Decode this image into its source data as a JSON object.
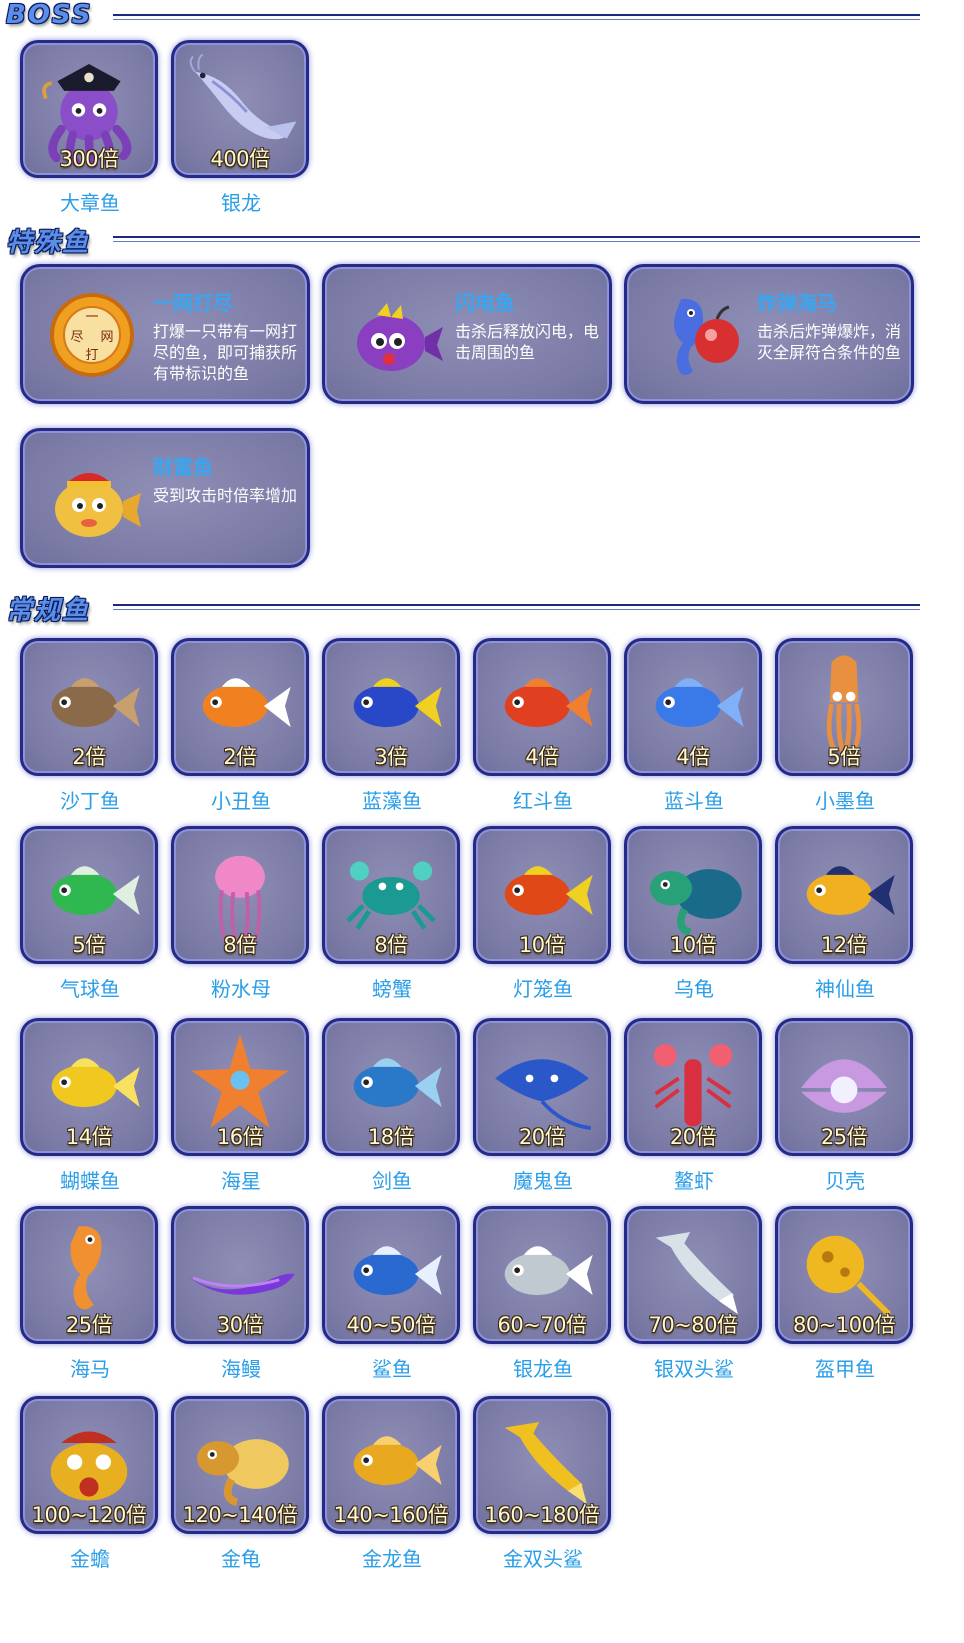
{
  "sections": {
    "boss": "BOSS",
    "special": "特殊鱼",
    "regular": "常规鱼"
  },
  "boss": [
    {
      "name": "大章鱼",
      "mult": "300倍",
      "icon": "purple-octopus-pirate-icon"
    },
    {
      "name": "银龙",
      "mult": "400倍",
      "icon": "silver-dragon-icon"
    }
  ],
  "special": [
    {
      "title": "一网打尽",
      "desc": "打爆一只带有一网打尽的鱼，即可捕获所有带标识的鱼",
      "icon": "one-net-coin-icon"
    },
    {
      "title": "闪电鱼",
      "desc": "击杀后释放闪电，电击周围的鱼",
      "icon": "lightning-pufferfish-icon"
    },
    {
      "title": "炸弹海马",
      "desc": "击杀后炸弹爆炸，消灭全屏符合条件的鱼",
      "icon": "bomb-seahorse-icon"
    },
    {
      "title": "财富鱼",
      "desc": "受到攻击时倍率增加",
      "icon": "fortune-fish-icon"
    }
  ],
  "regular": [
    {
      "name": "沙丁鱼",
      "mult": "2倍",
      "icon": "sardine-icon"
    },
    {
      "name": "小丑鱼",
      "mult": "2倍",
      "icon": "clownfish-icon"
    },
    {
      "name": "蓝藻鱼",
      "mult": "3倍",
      "icon": "blue-tang-icon"
    },
    {
      "name": "红斗鱼",
      "mult": "4倍",
      "icon": "red-betta-icon"
    },
    {
      "name": "蓝斗鱼",
      "mult": "4倍",
      "icon": "blue-betta-icon"
    },
    {
      "name": "小墨鱼",
      "mult": "5倍",
      "icon": "squid-icon"
    },
    {
      "name": "气球鱼",
      "mult": "5倍",
      "icon": "balloon-fish-icon"
    },
    {
      "name": "粉水母",
      "mult": "8倍",
      "icon": "pink-jellyfish-icon"
    },
    {
      "name": "螃蟹",
      "mult": "8倍",
      "icon": "crab-icon"
    },
    {
      "name": "灯笼鱼",
      "mult": "10倍",
      "icon": "lanternfish-icon"
    },
    {
      "name": "乌龟",
      "mult": "10倍",
      "icon": "turtle-icon"
    },
    {
      "name": "神仙鱼",
      "mult": "12倍",
      "icon": "angelfish-icon"
    },
    {
      "name": "蝴蝶鱼",
      "mult": "14倍",
      "icon": "butterfly-fish-icon"
    },
    {
      "name": "海星",
      "mult": "16倍",
      "icon": "starfish-icon"
    },
    {
      "name": "剑鱼",
      "mult": "18倍",
      "icon": "swordfish-icon"
    },
    {
      "name": "魔鬼鱼",
      "mult": "20倍",
      "icon": "manta-ray-icon"
    },
    {
      "name": "鳌虾",
      "mult": "20倍",
      "icon": "lobster-icon"
    },
    {
      "name": "贝壳",
      "mult": "25倍",
      "icon": "pearl-shell-icon"
    },
    {
      "name": "海马",
      "mult": "25倍",
      "icon": "seahorse-icon"
    },
    {
      "name": "海鳗",
      "mult": "30倍",
      "icon": "eel-icon"
    },
    {
      "name": "鲨鱼",
      "mult": "40~50倍",
      "icon": "shark-icon"
    },
    {
      "name": "银龙鱼",
      "mult": "60~70倍",
      "icon": "silver-arowana-icon"
    },
    {
      "name": "银双头鲨",
      "mult": "70~80倍",
      "icon": "silver-hammerhead-icon"
    },
    {
      "name": "盔甲鱼",
      "mult": "80~100倍",
      "icon": "armored-fish-icon"
    },
    {
      "name": "金蟾",
      "mult": "100~120倍",
      "icon": "golden-toad-icon"
    },
    {
      "name": "金龟",
      "mult": "120~140倍",
      "icon": "golden-turtle-icon"
    },
    {
      "name": "金龙鱼",
      "mult": "140~160倍",
      "icon": "golden-arowana-icon"
    },
    {
      "name": "金双头鲨",
      "mult": "160~180倍",
      "icon": "golden-hammerhead-icon"
    }
  ]
}
